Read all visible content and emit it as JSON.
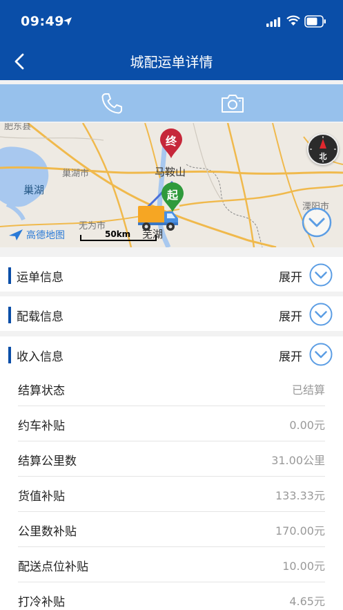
{
  "status_bar": {
    "time": "09:49"
  },
  "nav": {
    "title": "城配运单详情"
  },
  "map": {
    "labels": {
      "dongzhuang": "肥东县",
      "chaohu_city": "巢湖市",
      "chaohu_lake": "巢湖",
      "maanshan": "马鞍山",
      "wuweishi": "无为市",
      "wuhu": "芜湖",
      "liyang": "溧阳市"
    },
    "end_pin": "终",
    "start_pin": "起",
    "logo_text": "高德地图",
    "scale": "50km",
    "compass": "北"
  },
  "sections": [
    {
      "title": "运单信息",
      "toggle": "展开"
    },
    {
      "title": "配载信息",
      "toggle": "展开"
    },
    {
      "title": "收入信息",
      "toggle": "展开"
    }
  ],
  "income_rows": [
    {
      "label": "结算状态",
      "value": "已结算"
    },
    {
      "label": "约车补贴",
      "value": "0.00元"
    },
    {
      "label": "结算公里数",
      "value": "31.00公里"
    },
    {
      "label": "货值补贴",
      "value": "133.33元"
    },
    {
      "label": "公里数补贴",
      "value": "170.00元"
    },
    {
      "label": "配送点位补贴",
      "value": "10.00元"
    },
    {
      "label": "打冷补贴",
      "value": "4.65元"
    }
  ],
  "colors": {
    "header": "#0a4ea8",
    "action_bar": "#97c1ec",
    "accent": "#5b9de4"
  }
}
